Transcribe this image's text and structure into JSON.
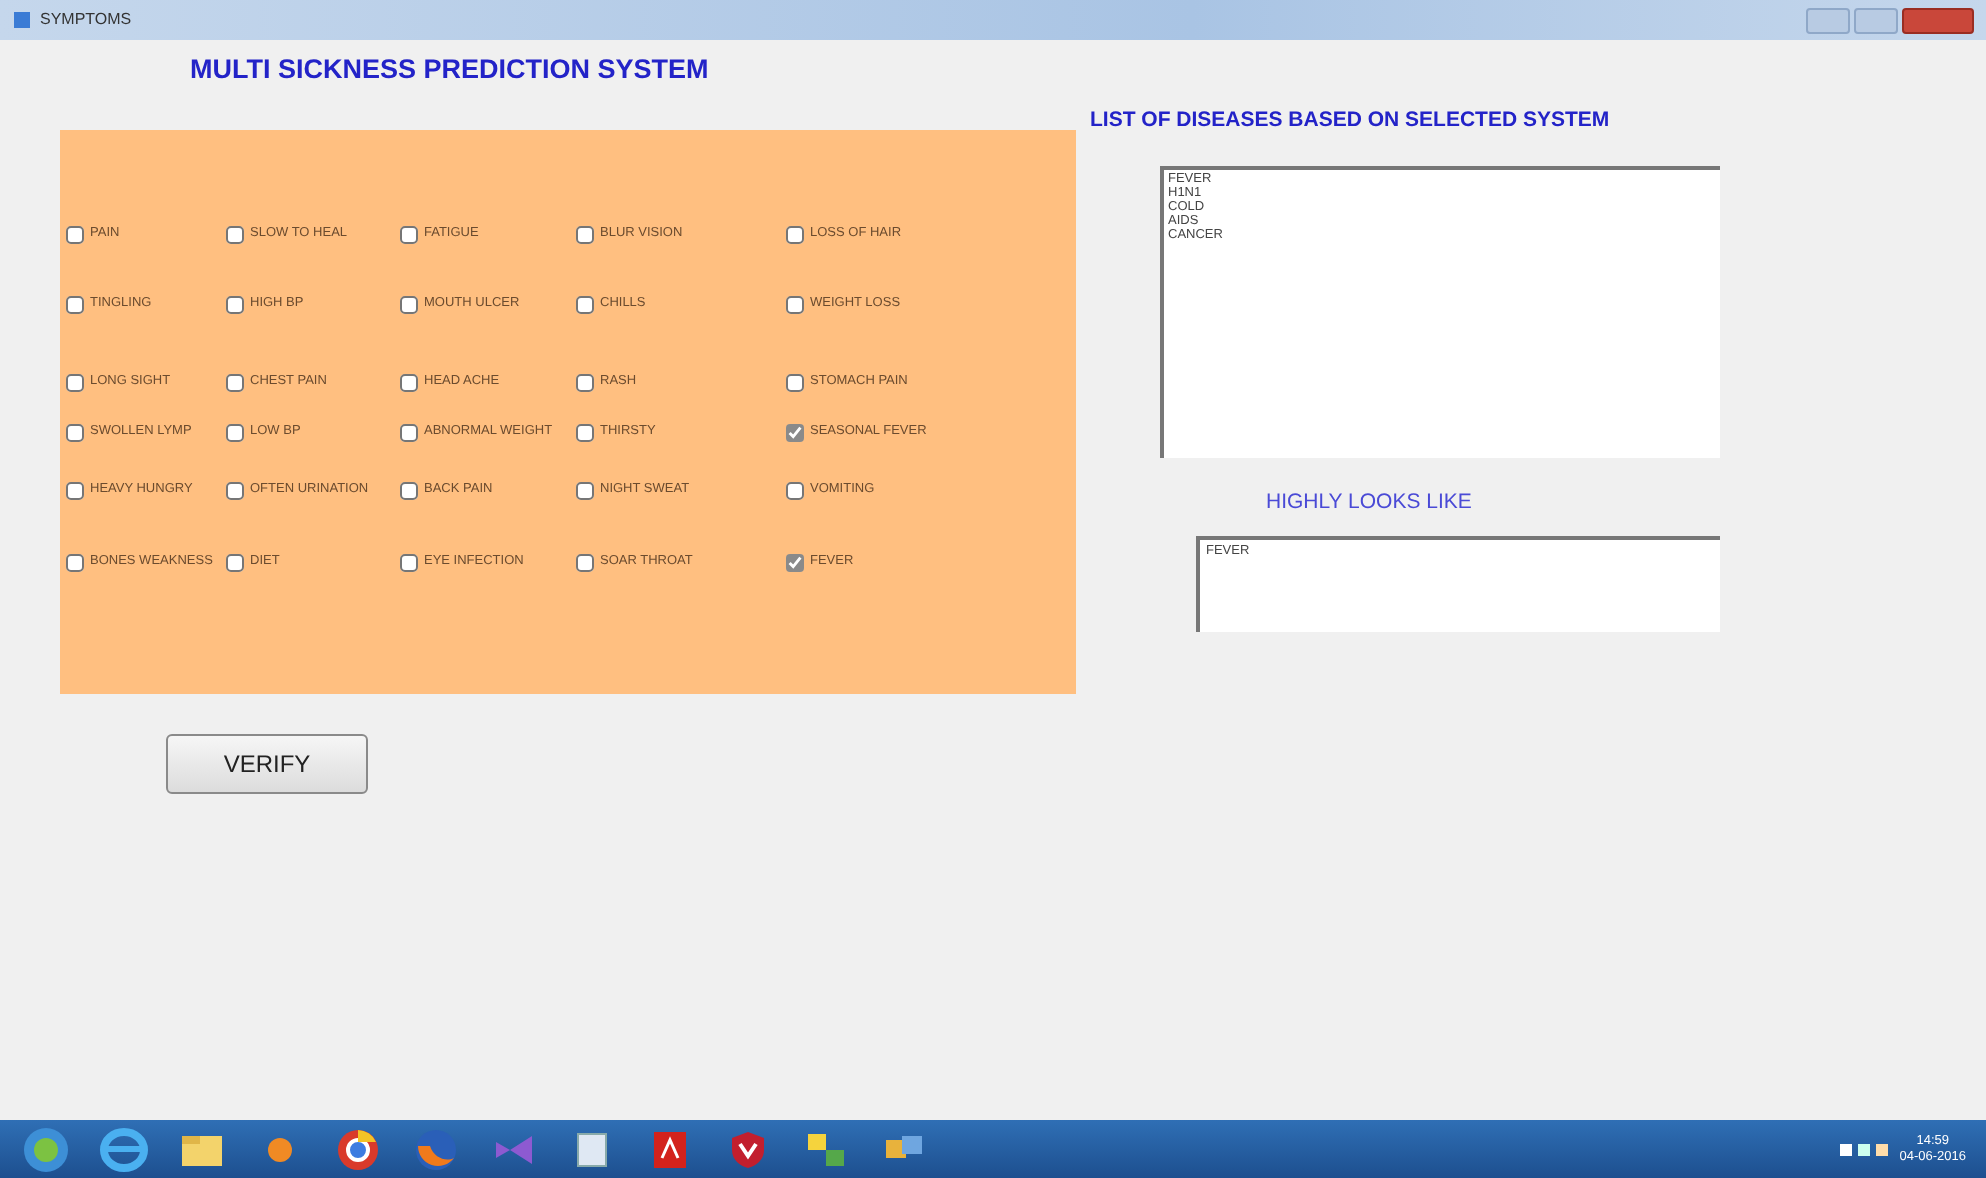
{
  "window": {
    "title": "SYMPTOMS"
  },
  "heading": "MULTI SICKNESS  PREDICTION SYSTEM",
  "symptom_rows": [
    [
      {
        "label": "PAIN",
        "checked": false
      },
      {
        "label": "SLOW TO HEAL",
        "checked": false
      },
      {
        "label": "FATIGUE",
        "checked": false
      },
      {
        "label": "BLUR VISION",
        "checked": false
      },
      {
        "label": "LOSS OF HAIR",
        "checked": false
      }
    ],
    [
      {
        "label": "TINGLING",
        "checked": false
      },
      {
        "label": "HIGH BP",
        "checked": false
      },
      {
        "label": "MOUTH ULCER",
        "checked": false
      },
      {
        "label": "CHILLS",
        "checked": false
      },
      {
        "label": "WEIGHT LOSS",
        "checked": false
      }
    ],
    [
      {
        "label": "LONG SIGHT",
        "checked": false
      },
      {
        "label": "CHEST PAIN",
        "checked": false
      },
      {
        "label": "HEAD ACHE",
        "checked": false
      },
      {
        "label": "RASH",
        "checked": false
      },
      {
        "label": "STOMACH PAIN",
        "checked": false
      }
    ],
    [
      {
        "label": "SWOLLEN LYMP",
        "checked": false
      },
      {
        "label": "LOW BP",
        "checked": false
      },
      {
        "label": "ABNORMAL WEIGHT",
        "checked": false
      },
      {
        "label": "THIRSTY",
        "checked": false
      },
      {
        "label": "SEASONAL FEVER",
        "checked": true
      }
    ],
    [
      {
        "label": "HEAVY HUNGRY",
        "checked": false
      },
      {
        "label": "OFTEN URINATION",
        "checked": false
      },
      {
        "label": "BACK PAIN",
        "checked": false
      },
      {
        "label": "NIGHT SWEAT",
        "checked": false
      },
      {
        "label": "VOMITING",
        "checked": false
      }
    ],
    [
      {
        "label": "BONES WEAKNESS",
        "checked": false
      },
      {
        "label": "DIET",
        "checked": false
      },
      {
        "label": "EYE INFECTION",
        "checked": false
      },
      {
        "label": "SOAR THROAT",
        "checked": false
      },
      {
        "label": "FEVER",
        "checked": true
      }
    ]
  ],
  "verify_button": "VERIFY",
  "diseases_heading": "LIST OF DISEASES BASED ON SELECTED SYSTEM",
  "diseases": [
    "FEVER",
    "H1N1",
    "COLD",
    "AIDS",
    "CANCER"
  ],
  "result_heading": "HIGHLY LOOKS LIKE",
  "result": "FEVER",
  "taskbar": {
    "time": "14:59",
    "date": "04-06-2016"
  }
}
